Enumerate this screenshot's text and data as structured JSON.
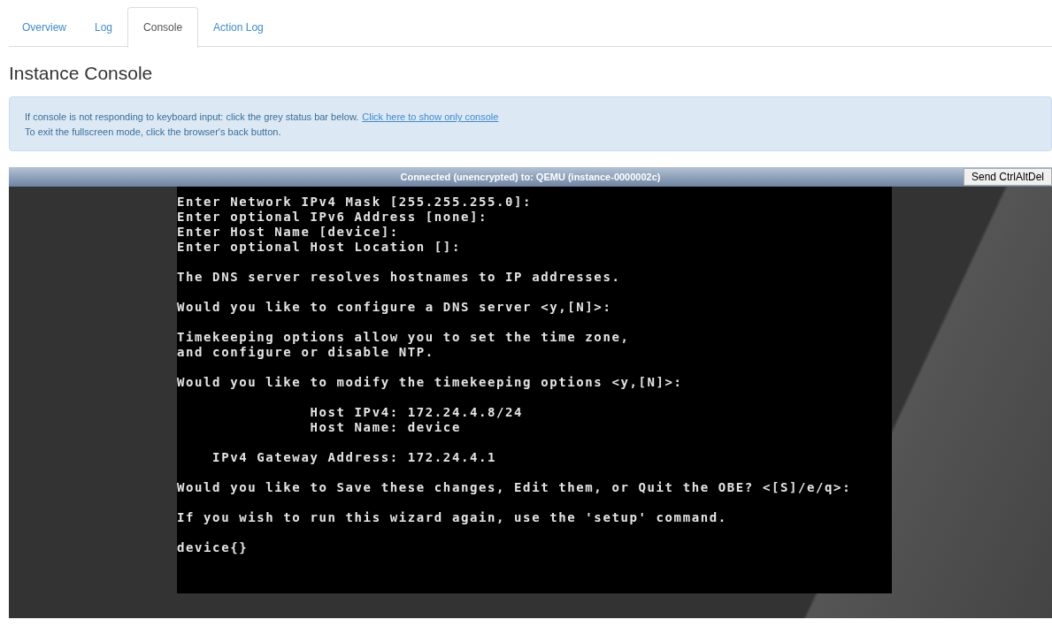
{
  "tabs": [
    {
      "label": "Overview",
      "selected": false
    },
    {
      "label": "Log",
      "selected": false
    },
    {
      "label": "Console",
      "selected": true
    },
    {
      "label": "Action Log",
      "selected": false
    }
  ],
  "heading": "Instance Console",
  "info": {
    "line_1": "If console is not responding to keyboard input: click the grey status bar below.",
    "link": "Click here to show only console",
    "line_2": "To exit the fullscreen mode, click the browser's back button."
  },
  "console": {
    "status": "Connected (unencrypted) to: QEMU (instance-0000002c)",
    "button": "Send CtrlAltDel",
    "paragraphs": [
      [
        "Enter Network IPv4 Mask [255.255.255.0]:",
        "Enter optional IPv6 Address [none]:",
        "Enter Host Name [device]:",
        "Enter optional Host Location []:"
      ],
      [
        "The DNS server resolves hostnames to IP addresses."
      ],
      [
        "Would you like to configure a DNS server <y,[N]>:"
      ],
      [
        "Timekeeping options allow you to set the time zone,",
        "and configure or disable NTP."
      ],
      [
        "Would you like to modify the timekeeping options <y,[N]>:"
      ],
      [
        "               Host IPv4: 172.24.4.8/24",
        "               Host Name: device"
      ],
      [
        "    IPv4 Gateway Address: 172.24.4.1"
      ],
      [
        "Would you like to Save these changes, Edit them, or Quit the OBE? <[S]/e/q>:"
      ],
      [
        "If you wish to run this wizard again, use the 'setup' command."
      ],
      [
        "device{}"
      ]
    ]
  }
}
